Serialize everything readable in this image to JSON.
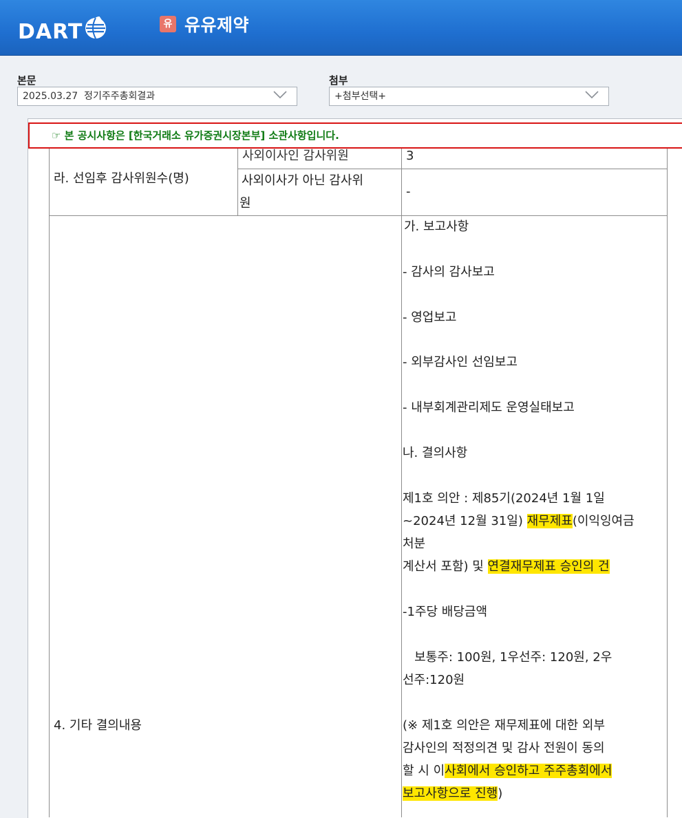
{
  "header": {
    "logo_text": "DART",
    "company_badge": "유",
    "company_name": "유유제약"
  },
  "selectors": {
    "main_label": "본문",
    "main_value": "2025.03.27  정기주주총회결과",
    "attach_label": "첨부",
    "attach_value": "+첨부선택+"
  },
  "notice": {
    "text": "☞ 본 공시사항은 [한국거래소 유가증권시장본부] 소관사항입니다."
  },
  "table": {
    "row_audit_label": "라. 선임후 감사위원수(명)",
    "row_outside_partial": "사외이사인 감사위원",
    "row_outside_value_partial": "3",
    "row_non_outside_label_1": "사외이사가 아닌 감사위",
    "row_non_outside_label_2": "원",
    "row_non_outside_value": "-",
    "row_other_label": "4. 기타 결의내용",
    "content": {
      "l1": "가. 보고사항",
      "l2": "- 감사의 감사보고",
      "l3": "- 영업보고",
      "l4": "- 외부감사인 선임보고",
      "l5": "- 내부회계관리제도 운영실태보고",
      "l6": "나. 결의사항",
      "l7": "제1호 의안 : 제85기(2024년 1월 1일",
      "l8a": "~2024년 12월 31일) ",
      "l8b": "재무제표",
      "l8c": "(이익잉여금",
      "l9": "처분",
      "l10a": "계산서 포함) 및 ",
      "l10b": "연결재무제표 승인의 건",
      "l11": "-1주당 배당금액",
      "l12": "   보통주: 100원, 1우선주: 120원, 2우",
      "l13": "선주:120원",
      "l14": "(※ 제1호 의안은 재무제표에 대한 외부",
      "l15": "감사인의 적정의견 및 감사 전원이 동의",
      "l16a": "할 시 이",
      "l16b": "사회에서 승인하고 주주총회에서",
      "l17a": "보고사항으로 진행",
      "l17b": ")"
    }
  },
  "colors": {
    "header_blue": "#1f6fd0",
    "notice_green": "#0e7a12",
    "notice_border": "#d81414",
    "highlight": "#ffe600"
  }
}
